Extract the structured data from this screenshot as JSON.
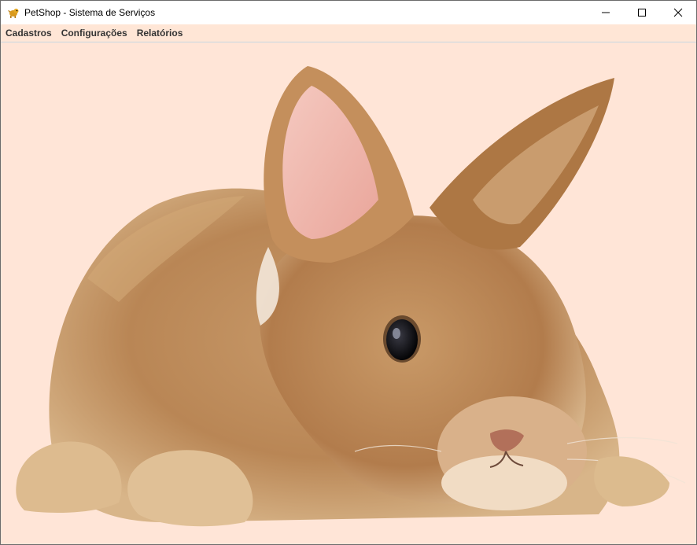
{
  "window": {
    "title": "PetShop - Sistema de Serviços",
    "controls": [
      "minimize-icon",
      "maximize-icon",
      "close-icon"
    ]
  },
  "menu": {
    "items": [
      {
        "label": "Cadastros"
      },
      {
        "label": "Configurações"
      },
      {
        "label": "Relatórios"
      }
    ]
  },
  "main": {
    "background_image": "rabbit-photo",
    "background_color": "#ffe5d7"
  }
}
